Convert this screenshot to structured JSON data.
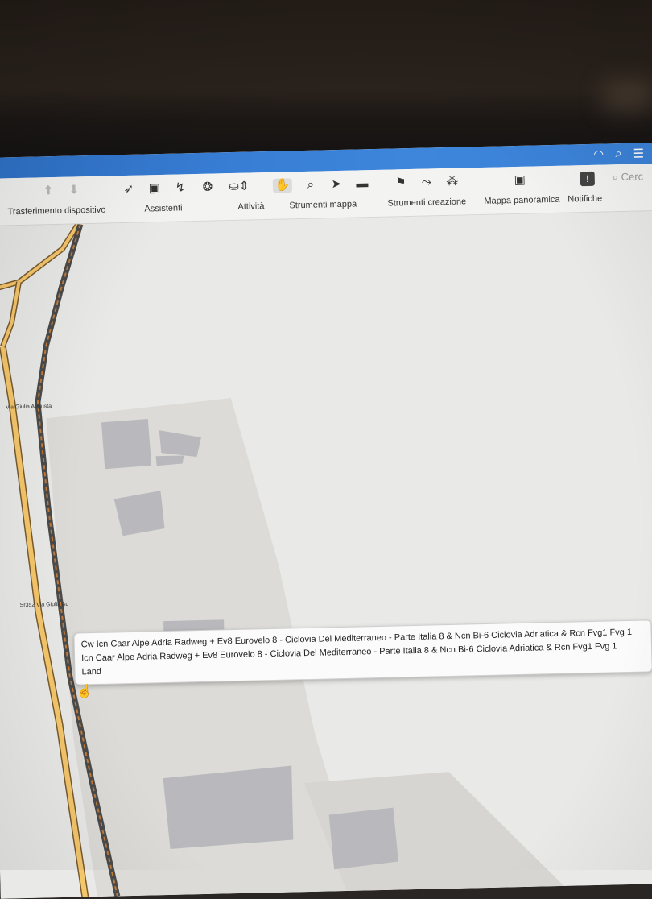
{
  "menubar": {
    "status_icons": [
      "wifi-icon",
      "search-icon",
      "control-center-icon"
    ]
  },
  "toolbar": {
    "groups": [
      {
        "label": "Trasferimento dispositivo",
        "icons": [
          "upload-icon",
          "download-icon"
        ]
      },
      {
        "label": "Assistenti",
        "icons": [
          "rocket-icon",
          "backpack-icon",
          "route-assistant-icon"
        ]
      },
      {
        "label": "Attività",
        "icons": [
          "spiral-icon",
          "cycling-icon"
        ]
      },
      {
        "label": "Strumenti mappa",
        "icons": [
          "hand-icon",
          "zoom-icon",
          "pointer-icon",
          "ruler-icon"
        ]
      },
      {
        "label": "Strumenti creazione",
        "icons": [
          "flag-icon",
          "route-icon",
          "footprints-icon"
        ]
      },
      {
        "label": "Mappa panoramica",
        "icons": [
          "overview-map-icon"
        ]
      },
      {
        "label": "Notifiche",
        "icons": [
          "notification-icon"
        ]
      }
    ],
    "search_placeholder": "Cerc"
  },
  "map": {
    "road_labels": [
      "Via Giulia Augusta",
      "Sr352 Via Giulia Au"
    ]
  },
  "tooltip": {
    "line1": "Cw Icn Caar Alpe Adria Radweg + Ev8 Eurovelo 8 - Ciclovia Del Mediterraneo - Parte Italia 8 & Ncn Bi-6 Ciclovia Adriatica & Rcn Fvg1 Fvg 1",
    "line2": "Icn Caar Alpe Adria Radweg + Ev8 Eurovelo 8 - Ciclovia Del Mediterraneo - Parte Italia 8 & Ncn Bi-6 Ciclovia Adriatica & Rcn Fvg1 Fvg 1",
    "line3": "Land"
  }
}
